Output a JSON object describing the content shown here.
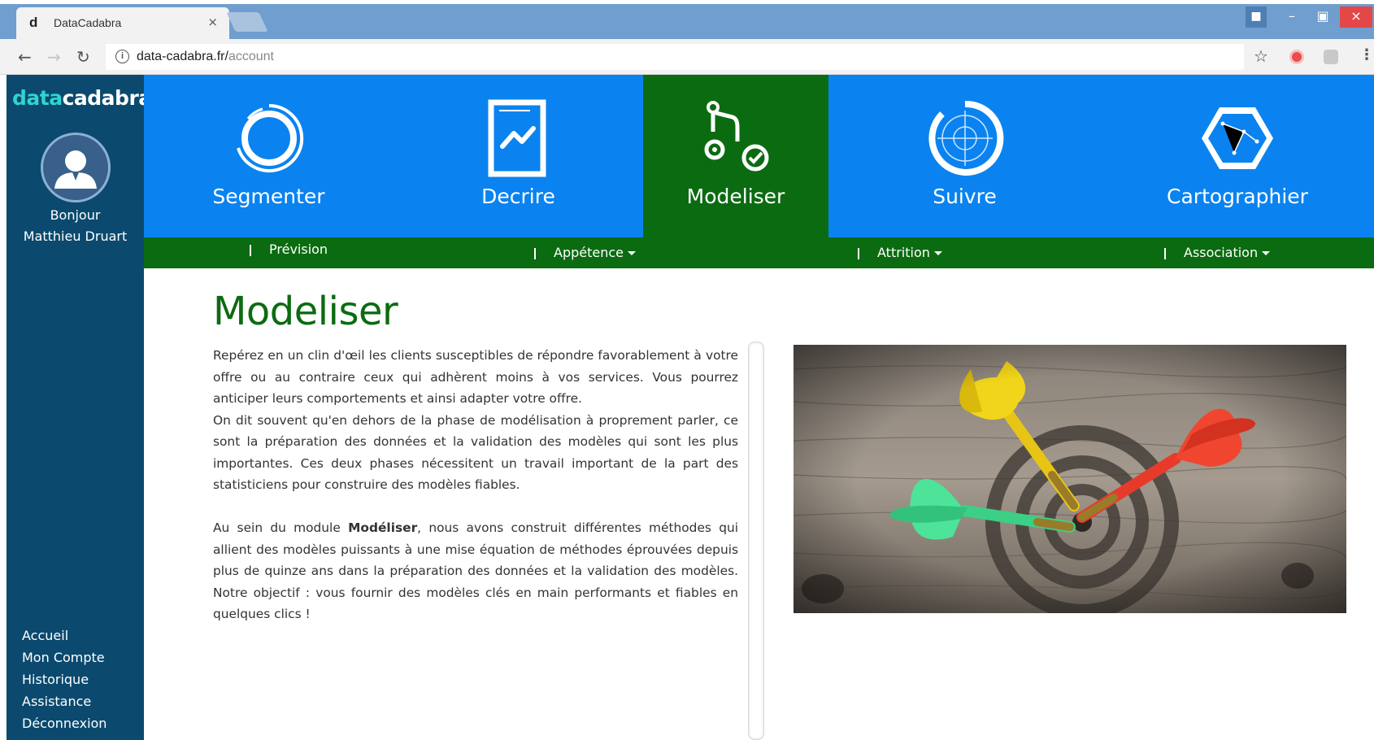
{
  "browser": {
    "tab_title": "DataCadabra",
    "tab_favicon": "d",
    "tab_close": "×",
    "url_host": "data-cadabra.fr/",
    "url_path": "account"
  },
  "brand": {
    "part1": "data",
    "part2": "cadabra"
  },
  "user": {
    "greeting": "Bonjour",
    "name": "Matthieu Druart"
  },
  "sidebar_links": [
    "Accueil",
    "Mon Compte",
    "Historique",
    "Assistance",
    "Déconnexion"
  ],
  "modules": [
    {
      "label": "Segmenter",
      "icon": "ring-icon",
      "active": false
    },
    {
      "label": "Decrire",
      "icon": "document-chart-icon",
      "active": false
    },
    {
      "label": "Modeliser",
      "icon": "stethoscope-icon",
      "active": true
    },
    {
      "label": "Suivre",
      "icon": "radar-icon",
      "active": false
    },
    {
      "label": "Cartographier",
      "icon": "hexagon-map-icon",
      "active": false
    }
  ],
  "subnav": [
    {
      "label": "Prévision",
      "dropdown": false
    },
    {
      "label": "Appétence",
      "dropdown": true
    },
    {
      "label": "Attrition",
      "dropdown": true
    },
    {
      "label": "Association",
      "dropdown": true
    }
  ],
  "content": {
    "title": "Modeliser",
    "para1": "Repérez en un clin d'œil les clients susceptibles de répondre favorablement à votre offre ou au contraire ceux qui adhèrent moins à vos services. Vous pourrez anticiper leurs comportements et ainsi adapter votre offre.",
    "para2": "On dit souvent qu'en dehors de la phase de modélisation à proprement parler, ce sont la préparation des données et la validation des modèles qui sont les plus importantes. Ces deux phases nécessitent un travail important de la part des statisticiens pour construire des modèles fiables.",
    "para3_before": "Au sein du module ",
    "para3_bold": "Modéliser",
    "para3_after": ", nous avons construit différentes méthodes qui allient des modèles puissants à une mise équation de méthodes éprouvées depuis plus de quinze ans dans la préparation des données et la validation des modèles. Notre objectif : vous fournir des modèles clés en main performants et fiables en quelques clics !"
  },
  "colors": {
    "tile_blue": "#0a83f0",
    "tile_green": "#0b6b11",
    "sidebar": "#0b4a6e",
    "title_green": "#0b6b11"
  }
}
